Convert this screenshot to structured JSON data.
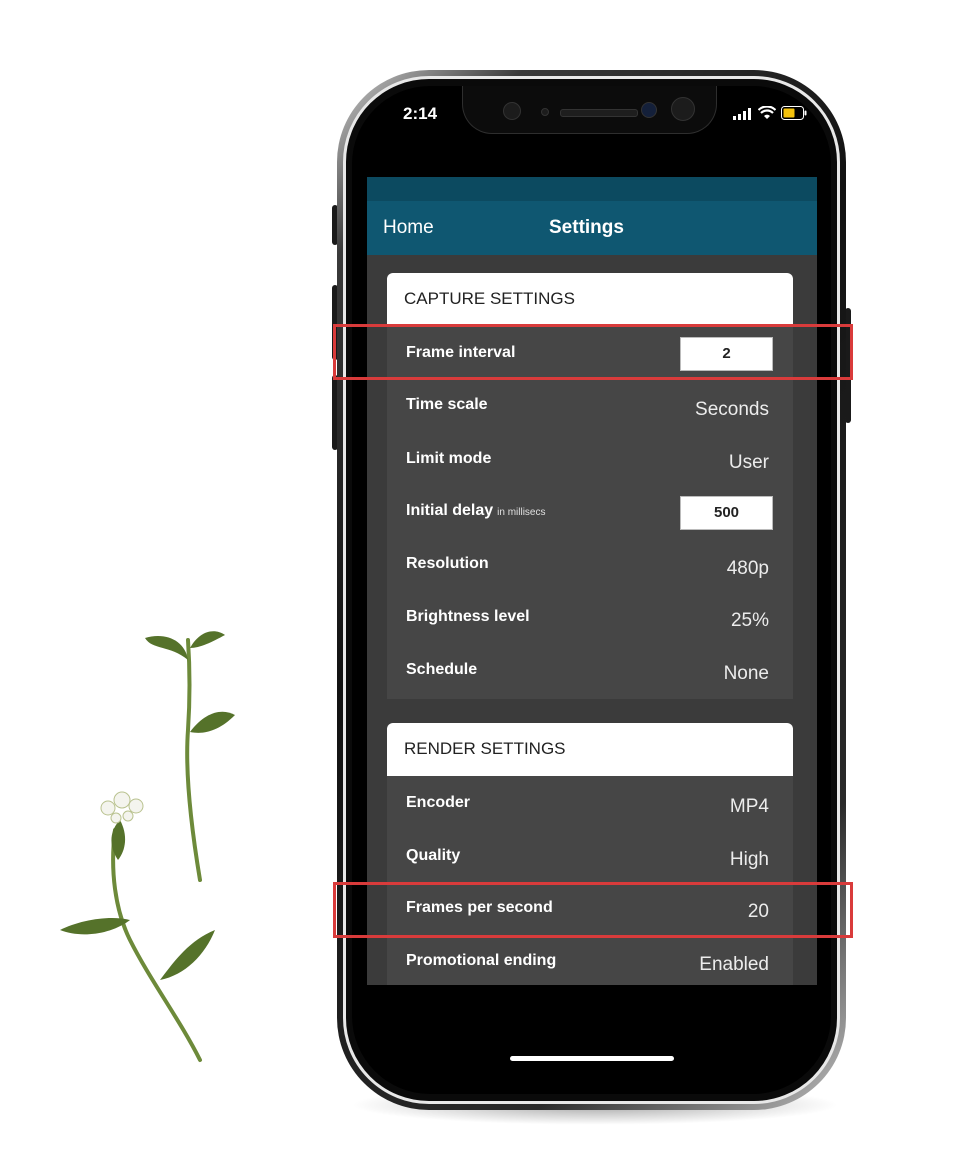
{
  "status_bar": {
    "time": "2:14"
  },
  "nav": {
    "back_label": "Home",
    "title": "Settings"
  },
  "capture": {
    "header": "CAPTURE SETTINGS",
    "rows": [
      {
        "label": "Frame interval",
        "value": "2"
      },
      {
        "label": "Time scale",
        "value": "Seconds"
      },
      {
        "label": "Limit mode",
        "value": "User"
      },
      {
        "label": "Initial delay",
        "note": "in millisecs",
        "value": "500"
      },
      {
        "label": "Resolution",
        "value": "480p"
      },
      {
        "label": "Brightness level",
        "value": "25%"
      },
      {
        "label": "Schedule",
        "value": "None"
      }
    ]
  },
  "render": {
    "header": "RENDER SETTINGS",
    "rows": [
      {
        "label": "Encoder",
        "value": "MP4"
      },
      {
        "label": "Quality",
        "value": "High"
      },
      {
        "label": "Frames per second",
        "value": "20"
      },
      {
        "label": "Promotional ending",
        "value": "Enabled"
      }
    ]
  },
  "colors": {
    "nav_bar": "#0f5771",
    "highlight": "#d93b3b",
    "panel": "#464646"
  }
}
